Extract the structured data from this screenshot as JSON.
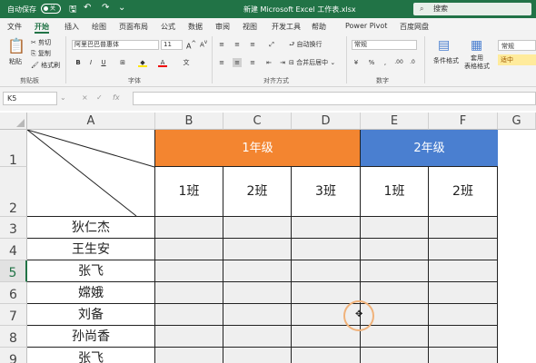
{
  "titlebar": {
    "autosave_label": "自动保存",
    "toggle_label": "关",
    "title": "新建 Microsoft Excel 工作表.xlsx",
    "search_placeholder": "搜索"
  },
  "tabs": [
    "文件",
    "开始",
    "插入",
    "绘图",
    "页面布局",
    "公式",
    "数据",
    "审阅",
    "视图",
    "开发工具",
    "帮助",
    "Power Pivot",
    "百度网盘"
  ],
  "active_tab": "开始",
  "ribbon": {
    "clipboard": {
      "paste": "粘贴",
      "cut": "剪切",
      "copy": "复制",
      "format_painter": "格式刷",
      "label": "剪贴板"
    },
    "font": {
      "name": "阿里巴巴普惠体",
      "size": "11",
      "label": "字体"
    },
    "alignment": {
      "wrap": "自动换行",
      "merge": "合并后居中",
      "label": "对齐方式"
    },
    "number": {
      "format": "常规",
      "label": "数字"
    },
    "styles": {
      "conditional": "条件格式",
      "table": "套用\n表格格式",
      "normal": "常规",
      "neutral": "适中"
    }
  },
  "formula_bar": {
    "name_box": "K5",
    "cancel": "×",
    "enter": "✓",
    "fx": "fx",
    "value": ""
  },
  "columns": [
    "A",
    "B",
    "C",
    "D",
    "E",
    "F",
    "G"
  ],
  "rows": [
    "1",
    "2",
    "3",
    "4",
    "5",
    "6",
    "7",
    "8",
    "9"
  ],
  "selected_row": "5",
  "sheet": {
    "grade1": "1年级",
    "grade2": "2年级",
    "classes": [
      "1班",
      "2班",
      "3班",
      "1班",
      "2班"
    ],
    "names": [
      "狄仁杰",
      "王生安",
      "张飞",
      "嫦娥",
      "刘备",
      "孙尚香",
      "张飞"
    ]
  },
  "colors": {
    "excel_green": "#217346",
    "grade1": "#f38530",
    "grade2": "#4a7fd0",
    "empty_cell": "#efefef"
  }
}
